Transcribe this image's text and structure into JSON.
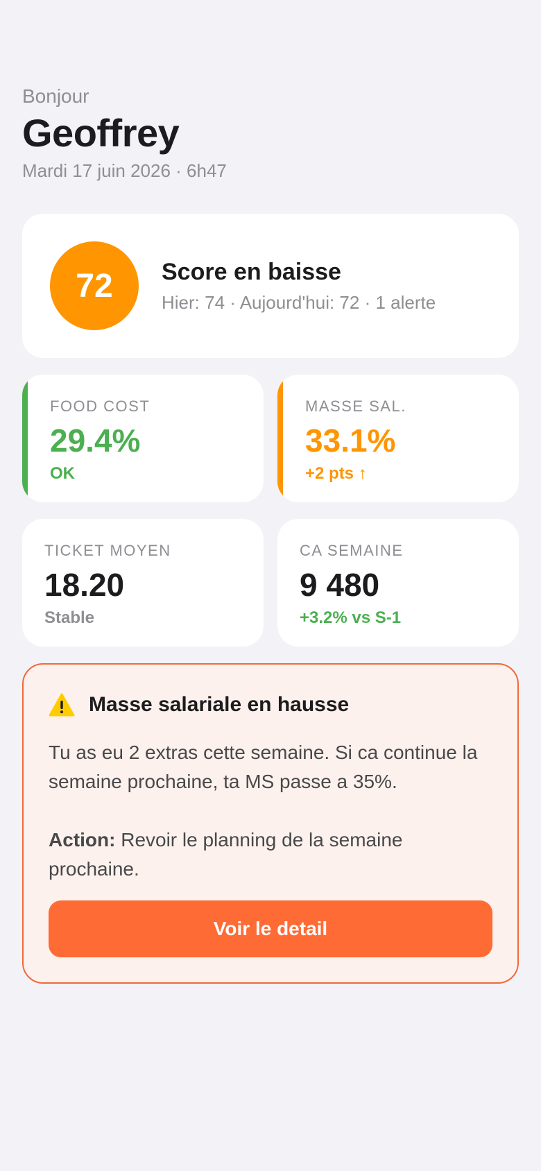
{
  "header": {
    "greeting": "Bonjour",
    "name": "Geoffrey",
    "date": "Mardi 17 juin 2026 · 6h47"
  },
  "score": {
    "value": "72",
    "title": "Score en baisse",
    "subtitle": "Hier: 74 · Aujourd'hui: 72 · 1 alerte",
    "color": "#ff9500"
  },
  "kpis": [
    {
      "label": "FOOD COST",
      "value": "29.4%",
      "note": "OK",
      "accent": "#4caf50"
    },
    {
      "label": "MASSE SAL.",
      "value": "33.1%",
      "note": "+2 pts ↑",
      "accent": "#ff9500"
    },
    {
      "label": "TICKET MOYEN",
      "value": "18.20",
      "note": "Stable"
    },
    {
      "label": "CA SEMAINE",
      "value": "9 480",
      "note": "+3.2% vs S-1",
      "note_color": "#4caf50"
    }
  ],
  "alert": {
    "icon": "warning-icon",
    "title": "Masse salariale en hausse",
    "body": "Tu as eu 2 extras cette semaine. Si ca continue la semaine prochaine, ta MS passe a 35%.",
    "action_label": "Action:",
    "action_text": " Revoir le planning de la semaine prochaine.",
    "button_label": "Voir le detail",
    "accent": "#ff6b35"
  }
}
